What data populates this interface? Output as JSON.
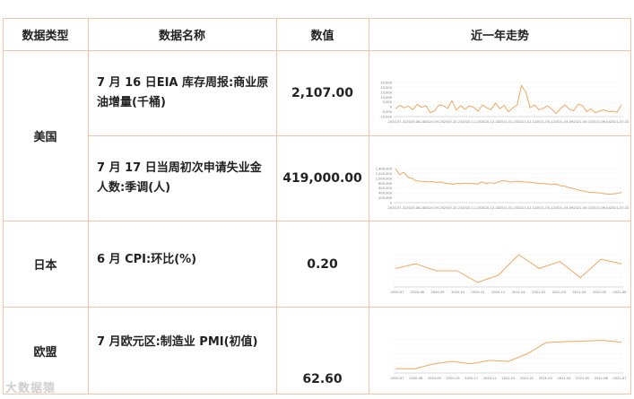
{
  "headers": {
    "type": "数据类型",
    "name": "数据名称",
    "value": "数值",
    "trend": "近一年走势"
  },
  "rows": [
    {
      "type": "美国",
      "name": "7 月 16 日EIA 库存周报:商业原油增量(千桶)",
      "value": "2,107.00"
    },
    {
      "type": "",
      "name": "7 月 17 日当周初次申请失业金人数:季调(人)",
      "value": "419,000.00"
    },
    {
      "type": "日本",
      "name": "6 月 CPI:环比(%)",
      "value": "0.20"
    },
    {
      "type": "欧盟",
      "name": "7 月欧元区:制造业 PMI(初值)",
      "value": "62.60"
    }
  ],
  "watermark": "大数据猿",
  "line_color": "#f0a860",
  "chart_data": [
    {
      "type": "line",
      "x": [
        "2020-07-31",
        "2020-08-28",
        "2020-09-25",
        "2020-10-23",
        "2020-11-20",
        "2020-12-18",
        "2021-01-15",
        "2021-02-12",
        "2021-03-12",
        "2021-04-09",
        "2021-05-07",
        "2021-06-04",
        "2021-07-02"
      ],
      "values": [
        -2000,
        1500,
        -1000,
        800,
        -3000,
        2500,
        -500,
        1200,
        -6000,
        -4000,
        2000,
        1000,
        -1500,
        6500,
        -3500,
        1200,
        -2500,
        1000,
        -500,
        -4500,
        1800,
        -1000,
        -3000,
        4000,
        -2000,
        1500,
        -5000,
        -1200,
        2000,
        22000,
        15000,
        -1000,
        2000,
        -3000,
        -1500,
        1000,
        -2500,
        -7000,
        -1500,
        2000,
        -2500,
        -4000,
        2500,
        1500,
        -5000,
        -2000,
        -6000,
        -4500,
        -3000,
        -5000,
        -4500,
        -5500,
        2100
      ],
      "ylim": [
        -10000,
        25000
      ],
      "yticks": [
        "25,000",
        "20,000",
        "15,000",
        "10,000",
        "5,000",
        "0",
        "-5,000",
        "-10,000"
      ]
    },
    {
      "type": "line",
      "x": [
        "2020-07-31",
        "2020-08-28",
        "2020-09-25",
        "2020-10-23",
        "2020-11-20",
        "2020-12-18",
        "2021-01-15",
        "2021-02-12",
        "2021-03-12",
        "2021-04-09",
        "2021-05-07",
        "2021-06-04",
        "2021-07-02"
      ],
      "values": [
        1400000,
        1150000,
        1250000,
        1050000,
        1000000,
        900000,
        880000,
        870000,
        850000,
        870000,
        830000,
        850000,
        800000,
        780000,
        760000,
        790000,
        780000,
        800000,
        790000,
        780000,
        760000,
        860000,
        790000,
        820000,
        780000,
        850000,
        900000,
        890000,
        840000,
        870000,
        880000,
        860000,
        850000,
        830000,
        810000,
        790000,
        780000,
        770000,
        740000,
        760000,
        700000,
        680000,
        630000,
        590000,
        540000,
        500000,
        470000,
        430000,
        420000,
        410000,
        395000,
        365000,
        350000,
        360000,
        380000,
        419000
      ],
      "ylim": [
        0,
        1400000
      ],
      "yticks": [
        "1,400,000",
        "1,200,000",
        "1,000,000",
        "800,000",
        "600,000",
        "400,000",
        "200,000",
        "0"
      ]
    },
    {
      "type": "line",
      "x": [
        "2020-07",
        "2020-08",
        "2020-09",
        "2020-10",
        "2020-11",
        "2020-12",
        "2021-01",
        "2021-02",
        "2021-03",
        "2021-04",
        "2021-05",
        "2021-06"
      ],
      "values": [
        0.0,
        0.2,
        -0.1,
        -0.1,
        -0.6,
        -0.3,
        0.6,
        0.0,
        0.3,
        -0.4,
        0.4,
        0.2
      ],
      "ylim": [
        -0.8,
        0.6
      ],
      "yticks": [
        "",
        "",
        "",
        "",
        "",
        "",
        "",
        ""
      ]
    },
    {
      "type": "line",
      "x": [
        "2020-07",
        "2020-08",
        "2020-09",
        "2020-10",
        "2020-11",
        "2020-12",
        "2021-01",
        "2021-02",
        "2021-03",
        "2021-04",
        "2021-05",
        "2021-06",
        "2021-07"
      ],
      "values": [
        51.8,
        51.7,
        53.7,
        54.8,
        53.8,
        55.2,
        54.8,
        57.9,
        62.5,
        62.9,
        63.1,
        63.4,
        62.6
      ],
      "ylim": [
        50,
        64
      ],
      "yticks": [
        "",
        "",
        "",
        "",
        "",
        "",
        "",
        ""
      ]
    }
  ]
}
